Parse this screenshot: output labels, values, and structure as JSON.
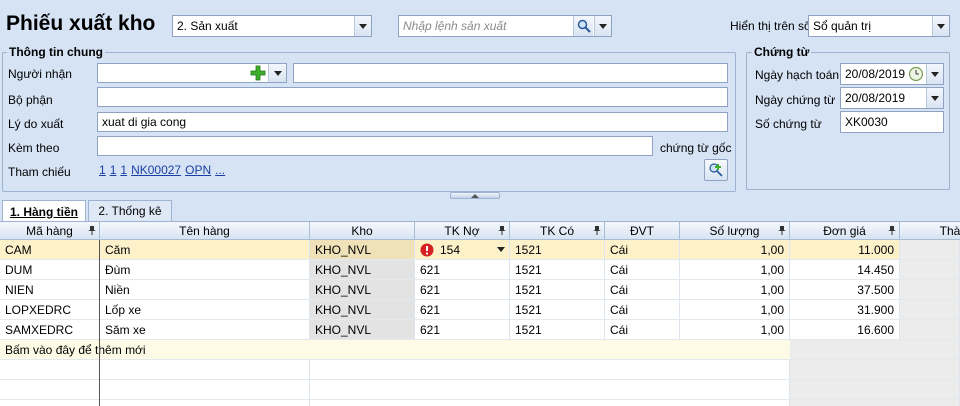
{
  "header": {
    "title": "Phiếu xuất kho",
    "type_value": "2. Sản xuất",
    "search_placeholder": "Nhập lệnh sản xuất",
    "display_label": "Hiển thị trên sổ",
    "display_value": "Sổ quản trị"
  },
  "general": {
    "title": "Thông tin chung",
    "nguoi_nhan_label": "Người nhận",
    "nguoi_nhan_value": "",
    "nguoi_nhan_name": "",
    "bo_phan_label": "Bộ phận",
    "bo_phan_value": "",
    "ly_do_label": "Lý do xuất",
    "ly_do_value": "xuat di gia cong",
    "kem_theo_label": "Kèm theo",
    "kem_theo_value": "",
    "chung_tu_goc": "chứng từ gốc",
    "tham_chieu_label": "Tham chiếu",
    "refs": [
      "1",
      "1",
      "1",
      "NK00027",
      "OPN",
      "..."
    ]
  },
  "voucher": {
    "title": "Chứng từ",
    "ngay_hach_toan_label": "Ngày hạch toán",
    "ngay_hach_toan": "20/08/2019",
    "ngay_chung_tu_label": "Ngày chứng từ",
    "ngay_chung_tu": "20/08/2019",
    "so_chung_tu_label": "Số chứng từ",
    "so_chung_tu": "XK0030"
  },
  "tabs": [
    {
      "label": "1. Hàng tiền"
    },
    {
      "label": "2. Thống kê"
    }
  ],
  "grid": {
    "columns": [
      "Mã hàng",
      "Tên hàng",
      "Kho",
      "TK Nợ",
      "TK Có",
      "ĐVT",
      "Số lượng",
      "Đơn giá",
      "Thàn"
    ],
    "rows": [
      {
        "ma": "CAM",
        "ten": "Căm",
        "kho": "KHO_NVL",
        "no": "154",
        "co": "1521",
        "dvt": "Cái",
        "sl": "1,00",
        "dg": "11.000"
      },
      {
        "ma": "DUM",
        "ten": "Đùm",
        "kho": "KHO_NVL",
        "no": "621",
        "co": "1521",
        "dvt": "Cái",
        "sl": "1,00",
        "dg": "14.450"
      },
      {
        "ma": "NIEN",
        "ten": "Niền",
        "kho": "KHO_NVL",
        "no": "621",
        "co": "1521",
        "dvt": "Cái",
        "sl": "1,00",
        "dg": "37.500"
      },
      {
        "ma": "LOPXEDRC",
        "ten": "Lốp xe",
        "kho": "KHO_NVL",
        "no": "621",
        "co": "1521",
        "dvt": "Cái",
        "sl": "1,00",
        "dg": "31.900"
      },
      {
        "ma": "SAMXEDRC",
        "ten": "Săm xe",
        "kho": "KHO_NVL",
        "no": "621",
        "co": "1521",
        "dvt": "Cái",
        "sl": "1,00",
        "dg": "16.600"
      }
    ],
    "add_new": "Bấm vào đây để thêm mới"
  },
  "icons": {
    "search": "search-icon",
    "add": "plus-icon",
    "calendar": "calendar-icon",
    "error": "error-icon"
  },
  "colors": {
    "background": "#d5e3f4",
    "selected_row": "#fdf1c9",
    "add_row": "#fdfbe6",
    "link": "#1b3fa6"
  }
}
